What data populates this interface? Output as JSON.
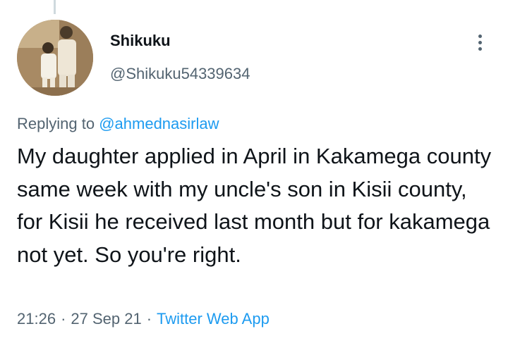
{
  "author": {
    "display_name": "Shikuku",
    "handle": "@Shikuku54339634",
    "avatar_icon": "profile-photo"
  },
  "menu": {
    "icon": "more-vertical-icon"
  },
  "reply": {
    "prefix": "Replying to",
    "mention": "@ahmednasirlaw"
  },
  "tweet": {
    "text": "My daughter applied in April in Kakamega county same week with my uncle's son in Kisii county, for Kisii he received last month but for kakamega not yet. So you're right."
  },
  "meta": {
    "time": "21:26",
    "separator": "·",
    "date": "27 Sep 21",
    "source": "Twitter Web App"
  },
  "colors": {
    "link": "#1d9bf0",
    "secondary_text": "#536471",
    "primary_text": "#0f1419"
  }
}
